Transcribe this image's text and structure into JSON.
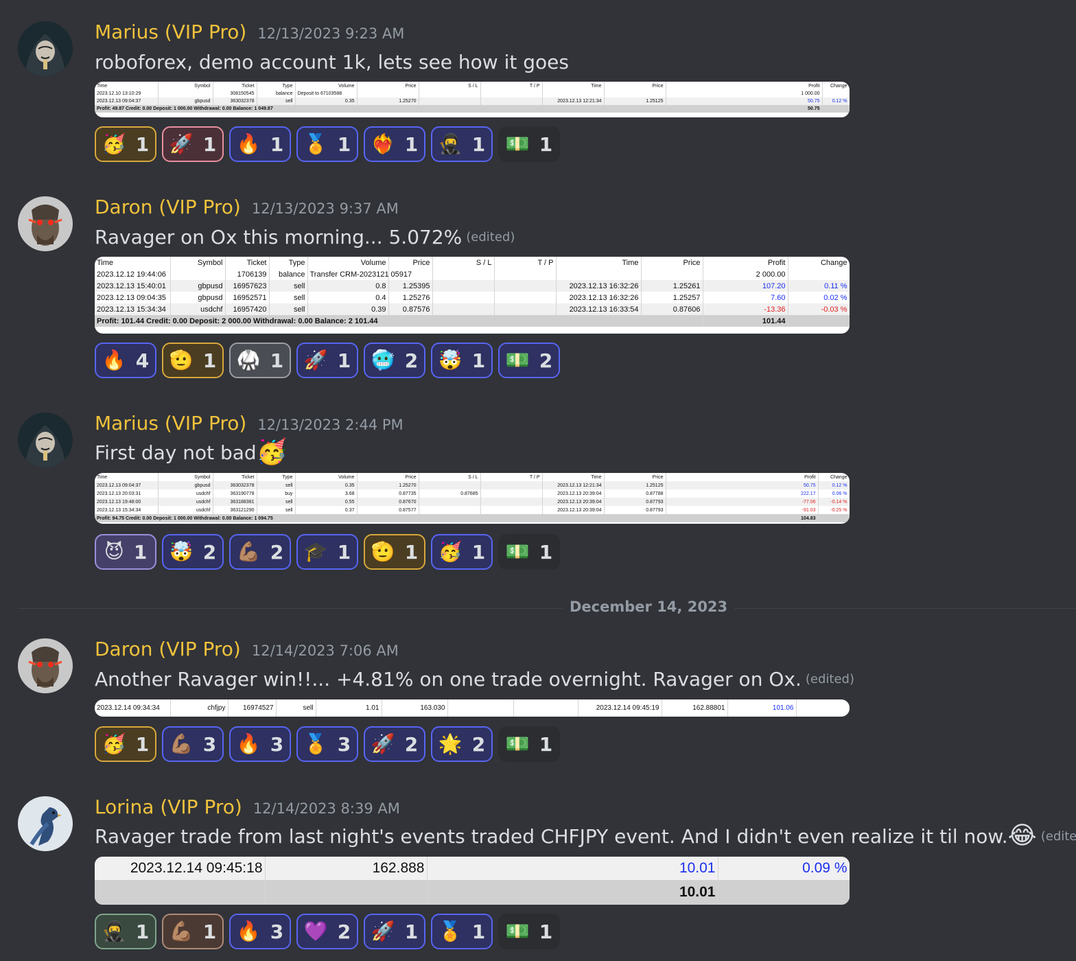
{
  "date_divider": "December 14, 2023",
  "messages": [
    {
      "user": "Marius (VIP Pro)",
      "timestamp": "12/13/2023 9:23 AM",
      "text": "roboforex, demo account 1k, lets see how it goes",
      "trade_table": {
        "headers": [
          "Time",
          "Symbol",
          "Ticket",
          "Type",
          "Volume",
          "Price",
          "S / L",
          "T / P",
          "Time",
          "Price",
          "Profit",
          "Change"
        ],
        "rows": [
          [
            "2023.12.10 13:10:29",
            "",
            "308150545",
            "balance",
            "Deposit to 67103588",
            "",
            "",
            "",
            "",
            "",
            "1 000.00",
            ""
          ],
          [
            "2023.12.13 09:04:37",
            "gbpusd",
            "363032378",
            "sell",
            "0.35",
            "1.25270",
            "",
            "",
            "2023.12.13 12:21:34",
            "1.25125",
            "50.75",
            "0.12 %"
          ]
        ],
        "summary": "Profit: 49.87  Credit: 0.00  Deposit: 1 000.00  Withdrawal: 0.00  Balance: 1 049.87",
        "summary_total": "50.75"
      },
      "reactions": [
        {
          "emoji": "🥳",
          "count": "1",
          "style": "gold"
        },
        {
          "emoji": "🚀",
          "count": "1",
          "style": "pink"
        },
        {
          "emoji": "🔥",
          "count": "1",
          "style": "blue"
        },
        {
          "emoji": "🏅",
          "count": "1",
          "style": "blue"
        },
        {
          "emoji": "❤️‍🔥",
          "count": "1",
          "style": "blue"
        },
        {
          "emoji": "🥷",
          "count": "1",
          "style": "blue"
        },
        {
          "emoji": "💵",
          "count": "1",
          "style": "plain"
        }
      ]
    },
    {
      "user": "Daron (VIP Pro)",
      "timestamp": "12/13/2023 9:37 AM",
      "text": "Ravager on Ox this morning...  5.072%",
      "edited": "(edited)",
      "trade_table": {
        "headers": [
          "Time",
          "Symbol",
          "Ticket",
          "Type",
          "Volume",
          "Price",
          "S / L",
          "T / P",
          "Time",
          "Price",
          "Profit",
          "Change"
        ],
        "rows": [
          [
            "2023.12.12 19:44:06",
            "",
            "1706139",
            "balance",
            "Transfer CRM-20231213012",
            "05917",
            "",
            "",
            "",
            "",
            "2 000.00",
            ""
          ],
          [
            "2023.12.13 15:40:01",
            "gbpusd",
            "16957623",
            "sell",
            "0.8",
            "1.25395",
            "",
            "",
            "2023.12.13 16:32:26",
            "1.25261",
            "107.20",
            "0.11 %"
          ],
          [
            "2023.12.13 09:04:35",
            "gbpusd",
            "16952571",
            "sell",
            "0.4",
            "1.25276",
            "",
            "",
            "2023.12.13 16:32:26",
            "1.25257",
            "7.60",
            "0.02 %"
          ],
          [
            "2023.12.13 15:34:34",
            "usdchf",
            "16957420",
            "sell",
            "0.39",
            "0.87576",
            "",
            "",
            "2023.12.13 16:33:54",
            "0.87606",
            "-13.36",
            "-0.03 %"
          ]
        ],
        "summary": "Profit: 101.44  Credit: 0.00  Deposit: 2 000.00  Withdrawal: 0.00  Balance: 2 101.44",
        "summary_total": "101.44"
      },
      "reactions": [
        {
          "emoji": "🔥",
          "count": "4",
          "style": "blue"
        },
        {
          "emoji": "🫡",
          "count": "1",
          "style": "gold"
        },
        {
          "emoji": "🥋",
          "count": "1",
          "style": "grey"
        },
        {
          "emoji": "🚀",
          "count": "1",
          "style": "blue"
        },
        {
          "emoji": "🥶",
          "count": "2",
          "style": "blue"
        },
        {
          "emoji": "🤯",
          "count": "1",
          "style": "blue"
        },
        {
          "emoji": "💵",
          "count": "2",
          "style": "blue"
        }
      ]
    },
    {
      "user": "Marius (VIP Pro)",
      "timestamp": "12/13/2023 2:44 PM",
      "text": "First day not bad",
      "inline_emoji": "🥳",
      "trade_table": {
        "headers": [
          "Time",
          "Symbol",
          "Ticket",
          "Type",
          "Volume",
          "Price",
          "S / L",
          "T / P",
          "Time",
          "Price",
          "Profit",
          "Change"
        ],
        "rows": [
          [
            "2023.12.13 09:04:37",
            "gbpusd",
            "363032378",
            "sell",
            "0.35",
            "1.25270",
            "",
            "",
            "2023.12.13 12:21:34",
            "1.25125",
            "50.75",
            "0.12 %"
          ],
          [
            "2023.12.13 20:03:31",
            "usdchf",
            "363190778",
            "buy",
            "3.68",
            "0.87735",
            "0.87685",
            "",
            "2023.12.13 20:39:04",
            "0.87788",
            "222.17",
            "0.06 %"
          ],
          [
            "2023.12.13 19:48:00",
            "usdchf",
            "363188381",
            "sell",
            "0.55",
            "0.87670",
            "",
            "",
            "2023.12.13 20:39:04",
            "0.87793",
            "-77.06",
            "-0.14 %"
          ],
          [
            "2023.12.13 15:34:34",
            "usdchf",
            "363121290",
            "sell",
            "0.37",
            "0.87577",
            "",
            "",
            "2023.12.13 20:39:04",
            "0.87793",
            "-91.03",
            "-0.25 %"
          ]
        ],
        "summary": "Profit: 94.75  Credit: 0.00  Deposit: 1 000.00  Withdrawal: 0.00  Balance: 1 094.75",
        "summary_total": "104.83"
      },
      "reactions": [
        {
          "emoji": "😈",
          "count": "1",
          "style": "purple"
        },
        {
          "emoji": "🤯",
          "count": "2",
          "style": "blue"
        },
        {
          "emoji": "💪🏽",
          "count": "2",
          "style": "blue"
        },
        {
          "emoji": "🎓",
          "count": "1",
          "style": "blue"
        },
        {
          "emoji": "🫡",
          "count": "1",
          "style": "gold"
        },
        {
          "emoji": "🥳",
          "count": "1",
          "style": "blue"
        },
        {
          "emoji": "💵",
          "count": "1",
          "style": "plain"
        }
      ]
    },
    {
      "user": "Daron (VIP Pro)",
      "timestamp": "12/14/2023 7:06 AM",
      "text": "Another Ravager win!!...   +4.81% on one trade overnight.  Ravager on Ox.",
      "edited": "(edited)",
      "trade_table": {
        "rows": [
          [
            "2023.12.14 09:34:34",
            "chfjpy",
            "16974527",
            "sell",
            "1.01",
            "163.030",
            "",
            "",
            "2023.12.14 09:45:19",
            "162.88801",
            "101.06",
            ""
          ]
        ]
      },
      "reactions": [
        {
          "emoji": "🥳",
          "count": "1",
          "style": "gold"
        },
        {
          "emoji": "💪🏽",
          "count": "3",
          "style": "blue"
        },
        {
          "emoji": "🔥",
          "count": "3",
          "style": "blue"
        },
        {
          "emoji": "🏅",
          "count": "3",
          "style": "blue"
        },
        {
          "emoji": "🚀",
          "count": "2",
          "style": "blue"
        },
        {
          "emoji": "🌟",
          "count": "2",
          "style": "blue"
        },
        {
          "emoji": "💵",
          "count": "1",
          "style": "plain"
        }
      ]
    },
    {
      "user": "Lorina (VIP Pro)",
      "timestamp": "12/14/2023 8:39 AM",
      "text": "Ravager trade from last night's events traded CHFJPY event.  And I didn't even realize it til now.",
      "inline_emoji": "😂",
      "edited": "(edited)",
      "trade_table": {
        "row": [
          "2023.12.14 09:45:18",
          "162.888",
          "10.01",
          "0.09 %"
        ],
        "summary_total": "10.01"
      },
      "reactions": [
        {
          "emoji": "🥷",
          "count": "1",
          "style": "green"
        },
        {
          "emoji": "💪🏽",
          "count": "1",
          "style": "brown"
        },
        {
          "emoji": "🔥",
          "count": "3",
          "style": "blue"
        },
        {
          "emoji": "💜",
          "count": "2",
          "style": "blue"
        },
        {
          "emoji": "🚀",
          "count": "1",
          "style": "blue"
        },
        {
          "emoji": "🏅",
          "count": "1",
          "style": "blue"
        },
        {
          "emoji": "💵",
          "count": "1",
          "style": "plain"
        }
      ]
    }
  ]
}
